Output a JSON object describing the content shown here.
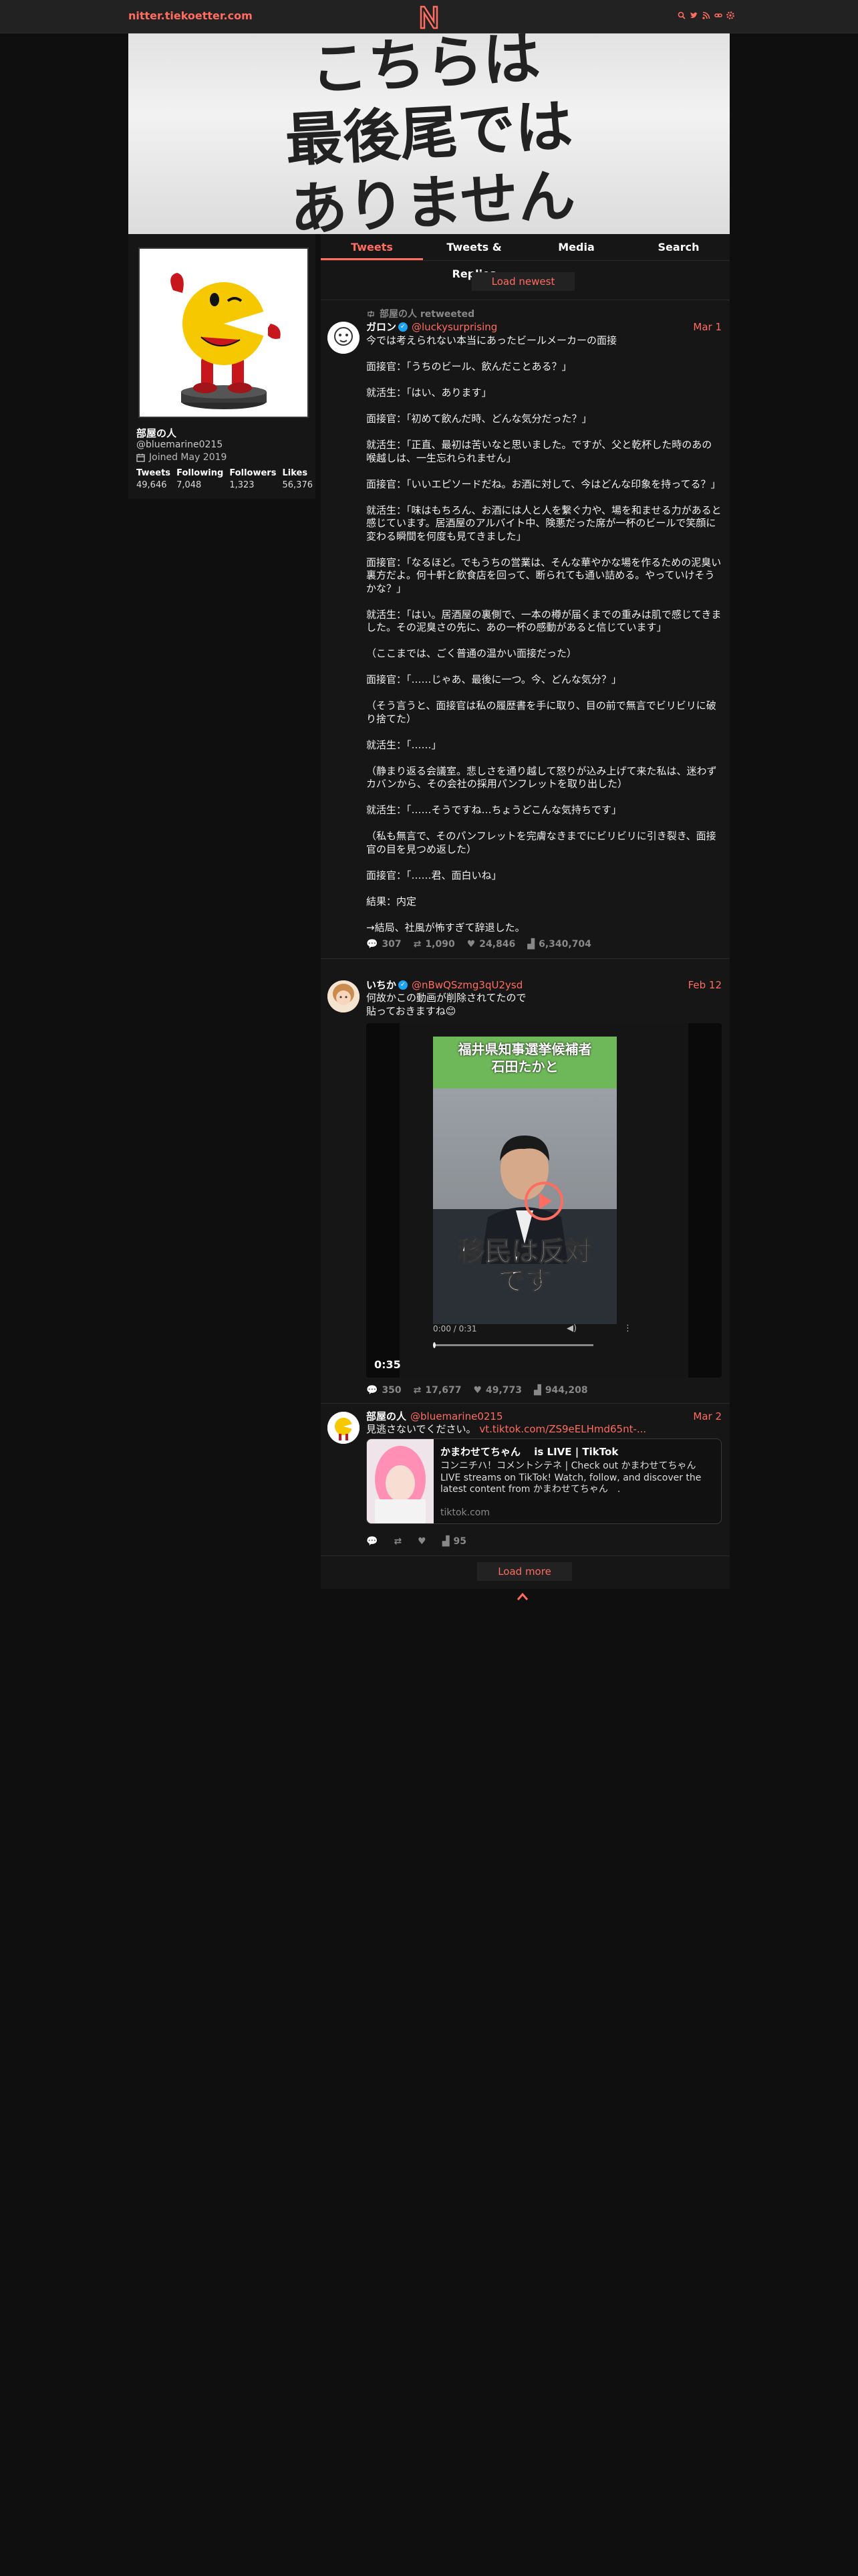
{
  "nav": {
    "brand": "nitter.tiekoetter.com",
    "logo": "N",
    "icons": [
      "search-icon",
      "twitter-icon",
      "rss-icon",
      "link-icon",
      "gear-icon"
    ]
  },
  "banner": {
    "lines": [
      "こちらは",
      "最後尾では",
      "ありません"
    ]
  },
  "profile": {
    "fullname": "部屋の人",
    "username": "@bluemarine0215",
    "joined": "Joined May 2019",
    "stats": [
      {
        "label": "Tweets",
        "value": "49,646"
      },
      {
        "label": "Following",
        "value": "7,048"
      },
      {
        "label": "Followers",
        "value": "1,323"
      },
      {
        "label": "Likes",
        "value": "56,376"
      }
    ]
  },
  "tabs": [
    "Tweets",
    "Tweets & Replies",
    "Media",
    "Search"
  ],
  "load_newest": "Load newest",
  "load_more": "Load more",
  "tweets": [
    {
      "retweet": "部屋の人 retweeted",
      "fullname": "ガロン",
      "username": "@luckysurprising",
      "date": "Mar 1",
      "body": "今では考えられない本当にあったビールメーカーの面接\n\n面接官：｢うちのビール、飲んだことある？｣\n\n就活生：｢はい、あります｣\n\n面接官：｢初めて飲んだ時、どんな気分だった？｣\n\n就活生：｢正直、最初は苦いなと思いました。ですが、父と乾杯した時のあの喉越しは、一生忘れられません｣\n\n面接官：｢いいエピソードだね。お酒に対して、今はどんな印象を持ってる？｣\n\n就活生：｢味はもちろん、お酒には人と人を繋ぐ力や、場を和ませる力があると感じています。居酒屋のアルバイト中、険悪だった席が一杯のビールで笑顔に変わる瞬間を何度も見てきました｣\n\n面接官：｢なるほど。でもうちの営業は、そんな華やかな場を作るための泥臭い裏方だよ。何十軒と飲食店を回って、断られても通い詰める。やっていけそうかな？｣\n\n就活生：｢はい。居酒屋の裏側で、一本の樽が届くまでの重みは肌で感じてきました。その泥臭さの先に、あの一杯の感動があると信じています｣\n\n（ここまでは、ごく普通の温かい面接だった）\n\n面接官：｢……じゃあ、最後に一つ。今、どんな気分？｣\n\n（そう言うと、面接官は私の履歴書を手に取り、目の前で無言でビリビリに破り捨てた）\n\n就活生：｢……｣\n\n（静まり返る会議室。悲しさを通り越して怒りが込み上げて来た私は、迷わずカバンから、その会社の採用パンフレットを取り出した）\n\n就活生：｢……そうですね…ちょうどこんな気持ちです｣\n\n（私も無言で、そのパンフレットを完膚なきまでにビリビリに引き裂き、面接官の目を見つめ返した）\n\n面接官：｢……君、面白いね｣\n\n結果：内定\n\n→結局、社風が怖すぎて辞退した。",
      "stats": {
        "replies": "307",
        "retweets": "1,090",
        "likes": "24,846",
        "views": "6,340,704"
      }
    },
    {
      "fullname": "いちか",
      "username": "@nBwQSzmg3qU2ysd",
      "date": "Feb 12",
      "body": "何故かこの動画が削除されてたので\n貼っておきますね😊",
      "video": {
        "overlay_top": [
          "福井県知事選挙候補者",
          "石田たかと"
        ],
        "overlay_bottom": [
          "移民は反対",
          "です"
        ],
        "time": "0:00 / 0:31",
        "duration": "0:35"
      },
      "stats": {
        "replies": "350",
        "retweets": "17,677",
        "likes": "49,773",
        "views": "944,208"
      }
    },
    {
      "fullname": "部屋の人",
      "username": "@bluemarine0215",
      "date": "Mar 2",
      "body_prefix": "見逃さないでください。 ",
      "link": "vt.tiktok.com/ZS9eELHmd65nt-...",
      "card": {
        "title": "かまわせてちゃん　 is LIVE | TikTok",
        "desc": "コンニチハ！コメントシテネ | Check out かまわせてちゃん　 LIVE streams on TikTok! Watch, follow, and discover the latest content from かまわせてちゃん　.",
        "domain": "tiktok.com"
      },
      "stats": {
        "replies": "",
        "retweets": "",
        "likes": "",
        "views": "95"
      }
    }
  ],
  "colors": {
    "accent": "#ff6c60",
    "bg": "#0f0f0f",
    "panel": "#161616"
  }
}
